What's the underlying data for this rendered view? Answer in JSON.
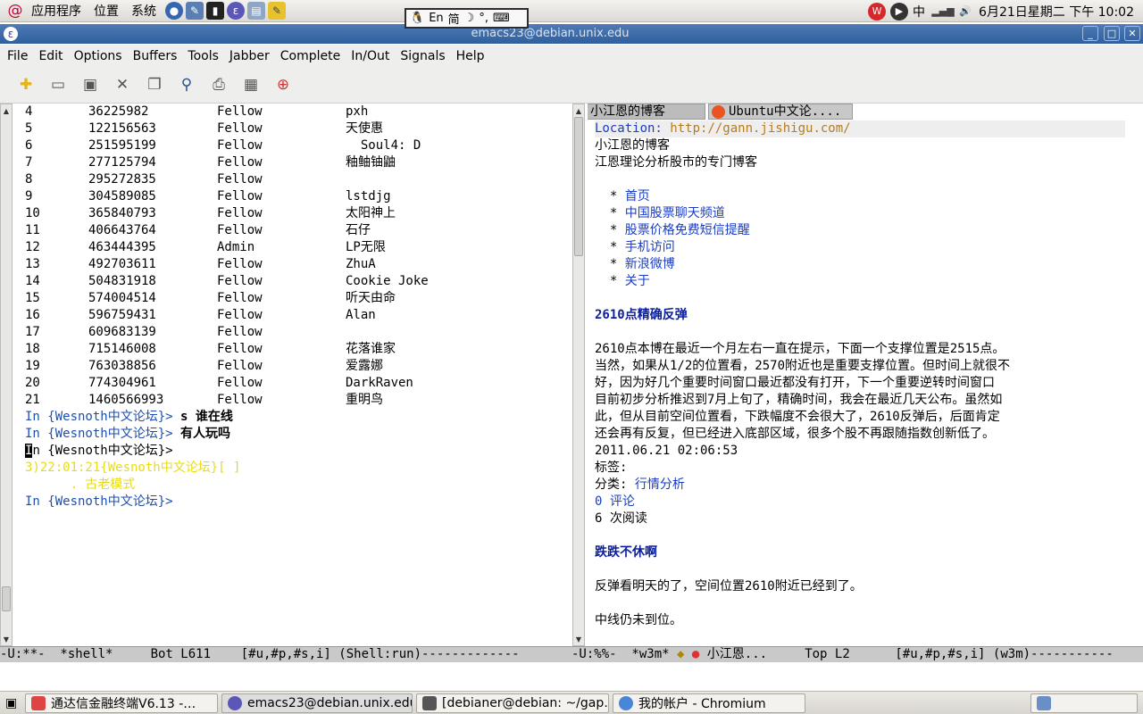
{
  "top_panel": {
    "menus": [
      "应用程序",
      "位置",
      "系统"
    ],
    "ime_lang": "En",
    "ime_mode": "简",
    "ime_extra": "°,",
    "indicator": "中",
    "datetime": "6月21日星期二  下午 10:02"
  },
  "window": {
    "title": "emacs23@debian.unix.edu"
  },
  "menubar": [
    "File",
    "Edit",
    "Options",
    "Buffers",
    "Tools",
    "Jabber",
    "Complete",
    "In/Out",
    "Signals",
    "Help"
  ],
  "shell": {
    "rows": [
      {
        "n": "4",
        "id": "36225982",
        "role": "Fellow",
        "nick": "pxh"
      },
      {
        "n": "5",
        "id": "122156563",
        "role": "Fellow",
        "nick": "天使惠"
      },
      {
        "n": "6",
        "id": "251595199",
        "role": "Fellow",
        "nick": "  Soul4: D"
      },
      {
        "n": "7",
        "id": "277125794",
        "role": "Fellow",
        "nick": "釉鲉铀鼬"
      },
      {
        "n": "8",
        "id": "295272835",
        "role": "Fellow",
        "nick": ""
      },
      {
        "n": "9",
        "id": "304589085",
        "role": "Fellow",
        "nick": "lstdjg"
      },
      {
        "n": "10",
        "id": "365840793",
        "role": "Fellow",
        "nick": "太阳神上"
      },
      {
        "n": "11",
        "id": "406643764",
        "role": "Fellow",
        "nick": "石仔"
      },
      {
        "n": "12",
        "id": "463444395",
        "role": "Admin",
        "nick": "LP无限"
      },
      {
        "n": "13",
        "id": "492703611",
        "role": "Fellow",
        "nick": "ZhuA"
      },
      {
        "n": "14",
        "id": "504831918",
        "role": "Fellow",
        "nick": "Cookie Joke"
      },
      {
        "n": "15",
        "id": "574004514",
        "role": "Fellow",
        "nick": "听天由命"
      },
      {
        "n": "16",
        "id": "596759431",
        "role": "Fellow",
        "nick": "Alan"
      },
      {
        "n": "17",
        "id": "609683139",
        "role": "Fellow",
        "nick": ""
      },
      {
        "n": "18",
        "id": "715146008",
        "role": "Fellow",
        "nick": "花落谁家"
      },
      {
        "n": "19",
        "id": "763038856",
        "role": "Fellow",
        "nick": "爱露娜"
      },
      {
        "n": "20",
        "id": "774304961",
        "role": "Fellow",
        "nick": "DarkRaven"
      },
      {
        "n": "21",
        "id": "1460566993",
        "role": "Fellow",
        "nick": "重明鸟"
      }
    ],
    "prompt": "In {Wesnoth中文论坛}>",
    "cmd1": " s 谁在线",
    "cmd2": " 有人玩吗",
    "current_prefix": "I",
    "current_rest": "n {Wesnoth中文论坛}>",
    "msg_line1": "3)22:01:21{Wesnoth中文论坛}[ ]",
    "msg_line2": "      . 古老模式",
    "mode_line": "-U:**-  *shell*     Bot L611    [#u,#p,#s,i] (Shell:run)-------------"
  },
  "w3m": {
    "tabs": [
      "小江恩的博客",
      "Ubuntu中文论...."
    ],
    "location_label": "Location:",
    "location_url": "http://gann.jishigu.com/",
    "site_title": "小江恩的博客",
    "site_desc": "江恩理论分析股市的专门博客",
    "nav": [
      "首页",
      "中国股票聊天频道",
      "股票价格免费短信提醒",
      "手机访问",
      "新浪微博",
      "关于"
    ],
    "post1_title": "2610点精确反弹",
    "post1_body": [
      "2610点本博在最近一个月左右一直在提示，下面一个支撑位置是2515点。",
      "当然，如果从1/2的位置看，2570附近也是重要支撑位置。但时间上就很不",
      "好，因为好几个重要时间窗口最近都没有打开，下一个重要逆转时间窗口",
      "目前初步分析推迟到7月上旬了，精确时间，我会在最近几天公布。虽然如",
      "此，但从目前空间位置看，下跌幅度不会很大了，2610反弹后，后面肯定",
      "还会再有反复，但已经进入底部区域，很多个股不再跟随指数创新低了。"
    ],
    "post1_date": "2011.06.21 02:06:53",
    "tags_label": "标签:",
    "category_label": "分类: ",
    "category": "行情分析",
    "comments_count": "0",
    "comments_label": "评论",
    "reads": "6 次阅读",
    "post2_title": "跌跌不休啊",
    "post2_line1": "反弹看明天的了，空间位置2610附近已经到了。",
    "post2_line2": "中线仍未到位。",
    "mode_line_a": "-U:%%-  *w3m* ",
    "mode_line_b": "小江恩...     Top L2      [#u,#p,#s,i] (w3m)-----------"
  },
  "taskbar": [
    "通达信金融终端V6.13 -…",
    "emacs23@debian.unix.edu",
    "[debianer@debian: ~/gap…",
    "我的帐户 - Chromium"
  ]
}
